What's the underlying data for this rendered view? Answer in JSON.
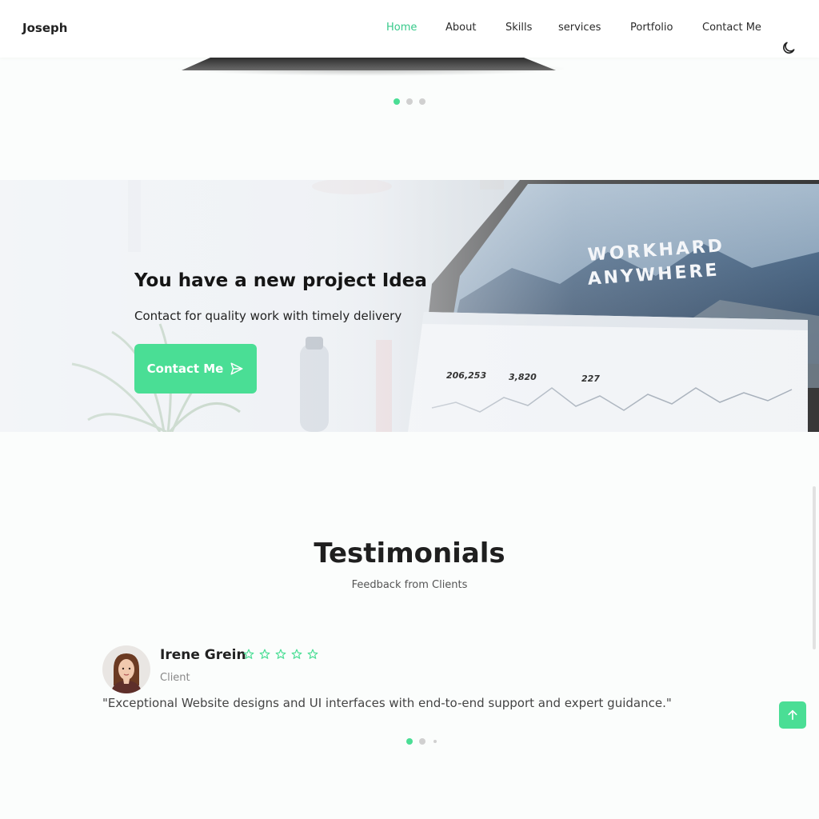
{
  "header": {
    "logo": "Joseph",
    "nav": [
      {
        "label": "Home",
        "active": true
      },
      {
        "label": "About",
        "active": false
      },
      {
        "label": "Skills",
        "active": false
      },
      {
        "label": "services",
        "active": false
      },
      {
        "label": "Portfolio",
        "active": false
      },
      {
        "label": "Contact Me",
        "active": false
      }
    ],
    "theme_icon": "moon-icon"
  },
  "carousel": {
    "active_index": 0,
    "count": 3
  },
  "banner": {
    "title": "You have a new project Idea",
    "subtitle": "Contact for quality work with timely delivery",
    "button_label": "Contact Me",
    "button_icon": "send-icon",
    "screen_text": {
      "line1": "WORKHARD",
      "line2": "ANYWHERE",
      "stat1": "206,253",
      "stat2": "3,820",
      "stat3": "227"
    }
  },
  "testimonials": {
    "title": "Testimonials",
    "subtitle": "Feedback from Clients",
    "items": [
      {
        "name": "Irene Grein",
        "role": "Client",
        "rating": 5,
        "quote": "\"Exceptional Website designs and UI interfaces with end-to-end support and expert guidance.\""
      }
    ],
    "active_index": 0,
    "count": 3
  },
  "colors": {
    "accent": "#4ade95",
    "accent_text": "#36c98a",
    "background": "#fbfdfc"
  },
  "scroll_top_icon": "arrow-up-icon"
}
